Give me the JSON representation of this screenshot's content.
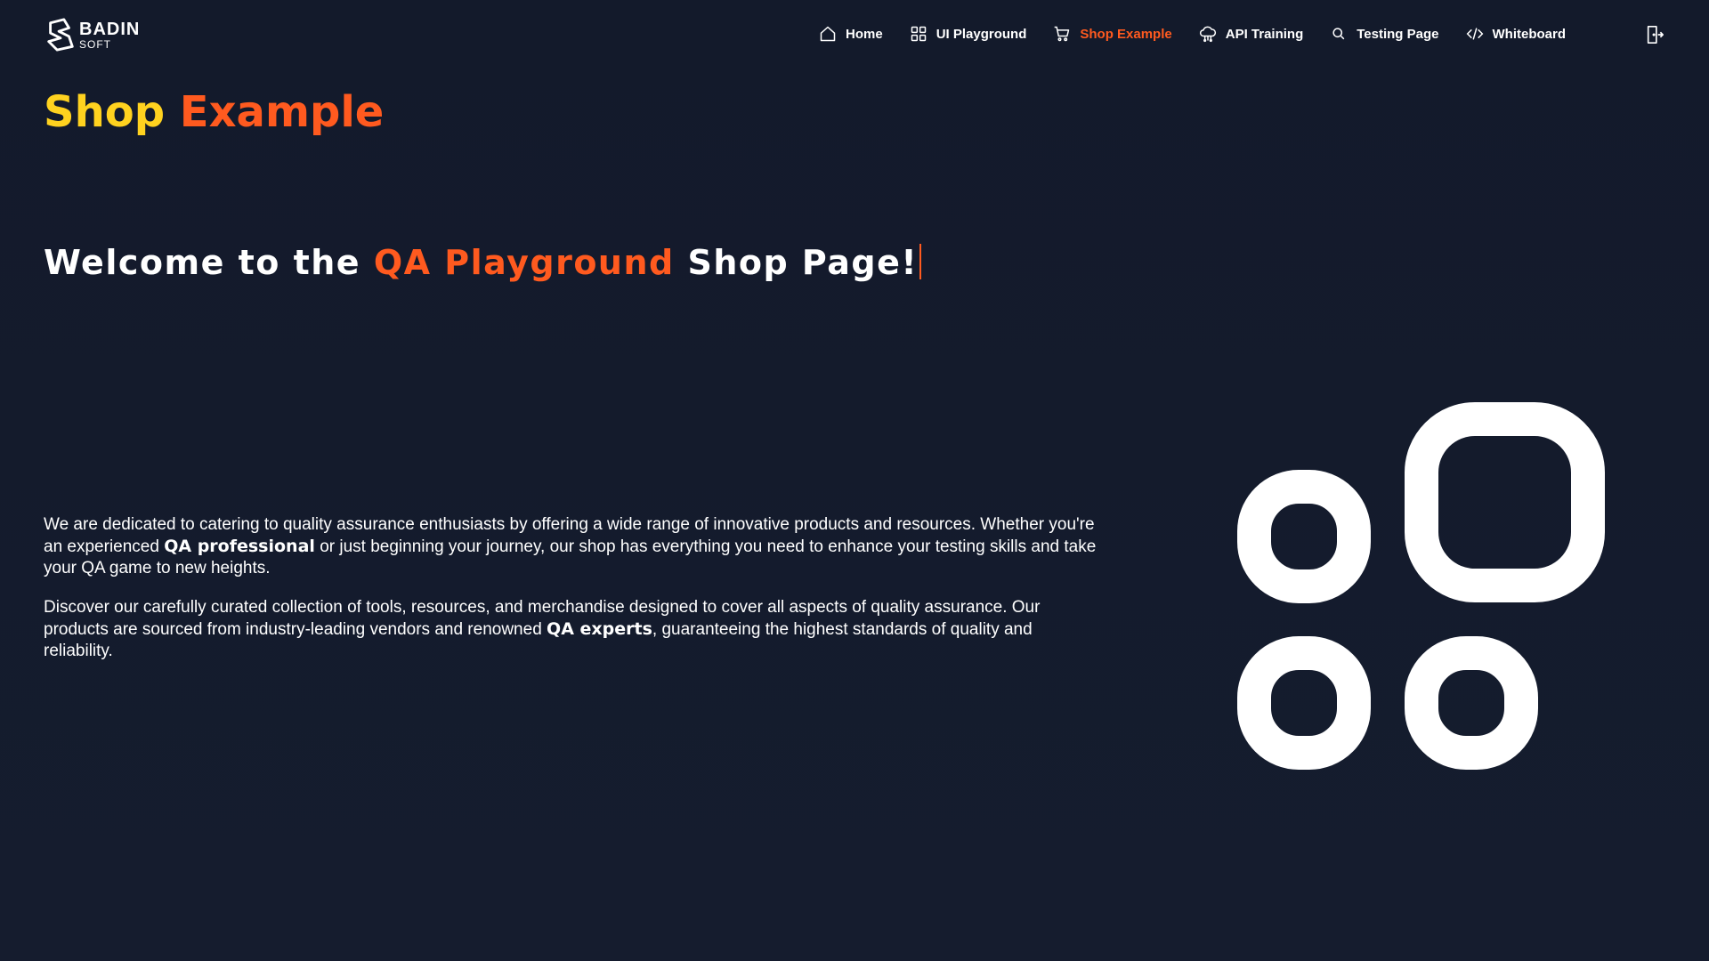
{
  "logo": {
    "line1": "BADIN",
    "line2": "SOFT"
  },
  "nav": {
    "items": [
      {
        "label": "Home",
        "icon": "home-icon"
      },
      {
        "label": "UI Playground",
        "icon": "grid-icon"
      },
      {
        "label": "Shop Example",
        "icon": "cart-icon",
        "active": true
      },
      {
        "label": "API Training",
        "icon": "cloud-network-icon"
      },
      {
        "label": "Testing Page",
        "icon": "search-icon"
      },
      {
        "label": "Whiteboard",
        "icon": "code-icon"
      }
    ],
    "logout_icon": "logout-icon"
  },
  "page_title": {
    "word1": "Shop",
    "word2": "Example"
  },
  "welcome": {
    "before": "Welcome to the ",
    "highlight": "QA Playground",
    "after": " Shop Page!"
  },
  "description": {
    "p1_a": "We are dedicated to catering to quality assurance enthusiasts by offering a wide range of innovative products and resources. Whether you're an experienced ",
    "p1_bold": "QA professional",
    "p1_b": " or just beginning your journey, our shop has everything you need to enhance your testing skills and take your QA game to new heights.",
    "p2_a": "Discover our carefully curated collection of tools, resources, and merchandise designed to cover all aspects of quality assurance. Our products are sourced from industry-leading vendors and renowned ",
    "p2_bold": "QA experts",
    "p2_b": ", guaranteeing the highest standards of quality and reliability."
  },
  "colors": {
    "background": "#141a2b",
    "accent": "#ff5a1f",
    "title_yellow": "#ffd21f",
    "text": "#ffffff"
  },
  "illustration_icon": "apps-grid-icon"
}
